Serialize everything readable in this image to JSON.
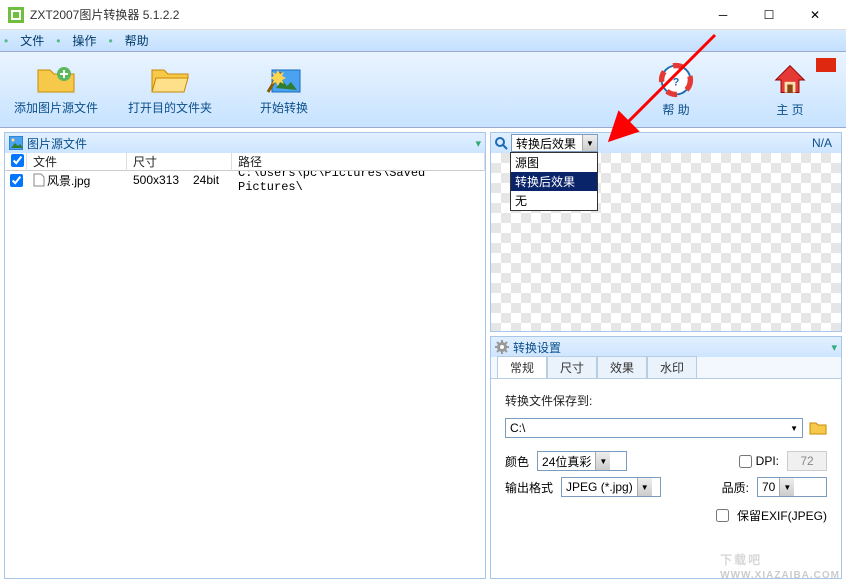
{
  "window": {
    "title": "ZXT2007图片转换器 5.1.2.2"
  },
  "menu": {
    "file": "文件",
    "op": "操作",
    "help": "帮助"
  },
  "toolbar": {
    "add_source": "添加图片源文件",
    "open_target": "打开目的文件夹",
    "start_convert": "开始转换",
    "help": "帮 助",
    "home": "主 页"
  },
  "source_panel": {
    "title": "图片源文件",
    "columns": {
      "file": "文件",
      "size": "尺寸",
      "path": "路径"
    },
    "rows": [
      {
        "checked": true,
        "name": "风景.jpg",
        "size": "500x313",
        "bits": "24bit",
        "path": "C:\\Users\\pc\\Pictures\\Saved Pictures\\"
      }
    ]
  },
  "preview": {
    "selector_value": "转换后效果",
    "options": {
      "src": "源图",
      "after": "转换后效果",
      "none": "无"
    },
    "status": "N/A"
  },
  "settings": {
    "title": "转换设置",
    "tabs": {
      "general": "常规",
      "size": "尺寸",
      "effect": "效果",
      "watermark": "水印"
    },
    "save_to_label": "转换文件保存到:",
    "save_path": "C:\\",
    "color_label": "颜色",
    "color_value": "24位真彩",
    "dpi_label": "DPI:",
    "dpi_value": "72",
    "format_label": "输出格式",
    "format_value": "JPEG (*.jpg)",
    "quality_label": "品质:",
    "quality_value": "70",
    "exif_label": "保留EXIF(JPEG)"
  },
  "watermark_text": "下载吧"
}
